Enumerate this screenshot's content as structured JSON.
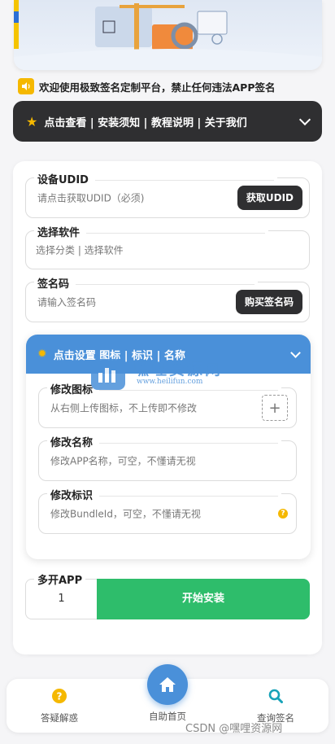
{
  "notice": {
    "text": "欢迎使用极致签名定制平台，禁止任何违法APP签名"
  },
  "menu_bar": {
    "label": "点击查看 | 安装须知 | 教程说明 | 关于我们"
  },
  "udid": {
    "legend": "设备UDID",
    "placeholder": "请点击获取UDID（必须)",
    "button": "获取UDID"
  },
  "software": {
    "legend": "选择软件",
    "placeholder": "选择分类 | 选择软件"
  },
  "code": {
    "legend": "签名码",
    "placeholder": "请输入签名码",
    "button": "购买签名码"
  },
  "settings": {
    "title": "点击设置 图标 | 标识 | 名称",
    "icon_field": {
      "legend": "修改图标",
      "placeholder": "从右侧上传图标，不上传即不修改",
      "plus": "+"
    },
    "name_field": {
      "legend": "修改名称",
      "placeholder": "修改APP名称，可空，不懂请无视"
    },
    "bundle_field": {
      "legend": "修改标识",
      "placeholder": "修改BundleId，可空，不懂请无视",
      "help": "?"
    }
  },
  "install": {
    "qty_legend": "多开APP",
    "qty_value": "1",
    "button": "开始安装"
  },
  "watermark": {
    "name": "嘿哩资源网",
    "url": "www.heilifun.com"
  },
  "bottom_nav": {
    "help": "答疑解惑",
    "home": "自助首页",
    "query": "查询签名"
  },
  "footer_watermark": "CSDN @嘿哩资源网",
  "colors": {
    "accent": "#4a90d9",
    "install": "#2ebd6b",
    "dark": "#2f2f31",
    "warn": "#f5b800"
  }
}
